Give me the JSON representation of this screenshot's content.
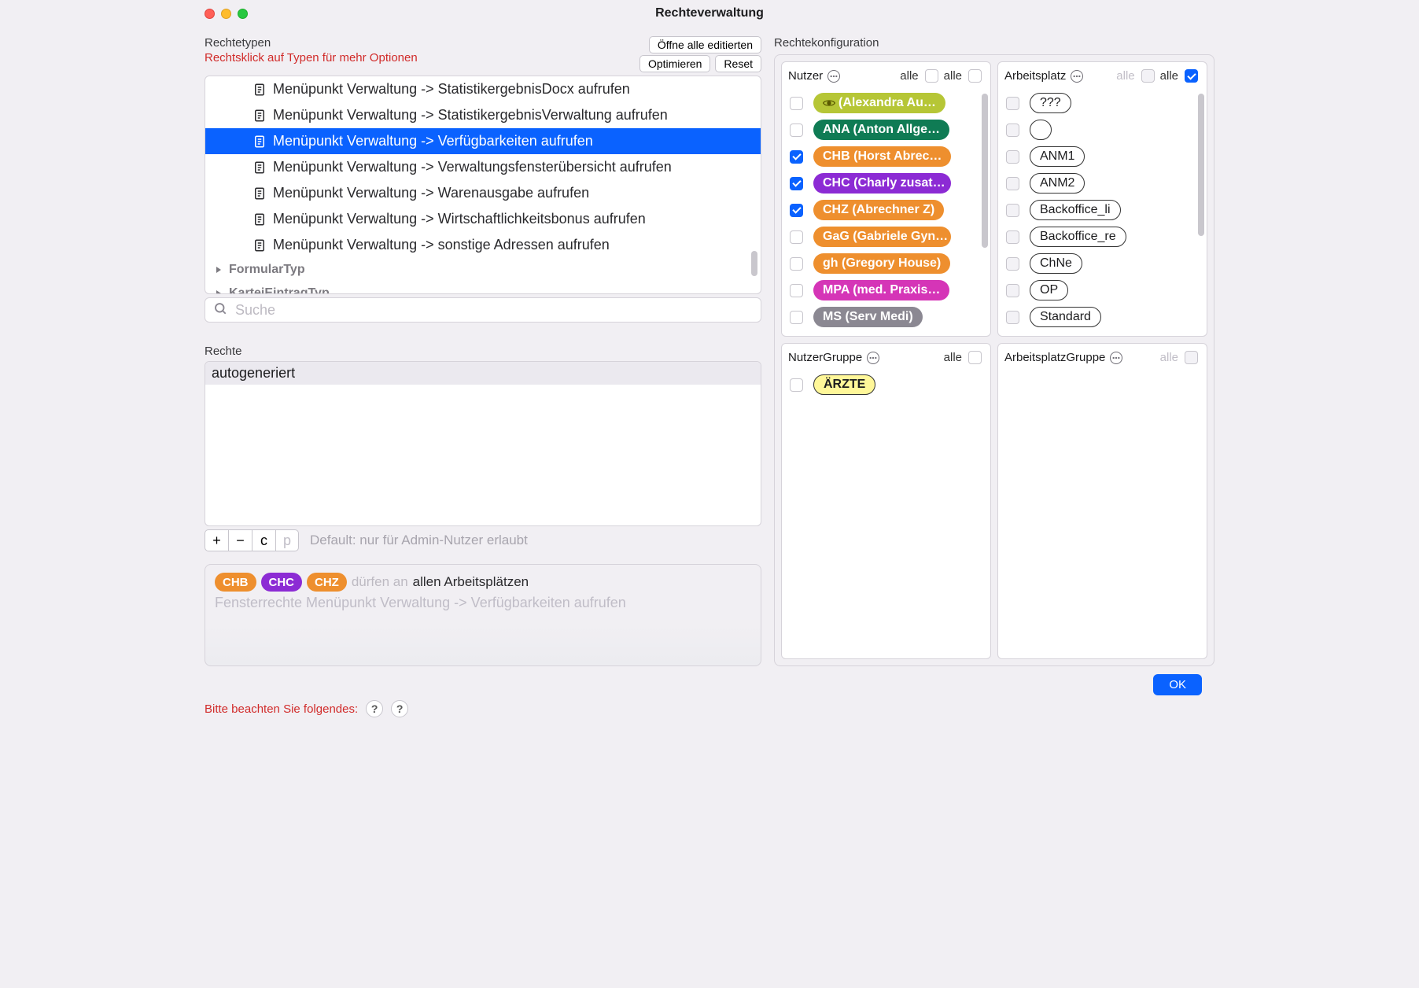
{
  "window": {
    "title": "Rechteverwaltung"
  },
  "left": {
    "header": "Rechtetypen",
    "sub": "Rechtsklick auf Typen für mehr Optionen",
    "buttons": {
      "open_all": "Öffne alle editierten",
      "optimize": "Optimieren",
      "reset": "Reset"
    },
    "tree": {
      "items": [
        "Menüpunkt Verwaltung -> StatistikergebnisDocx aufrufen",
        "Menüpunkt Verwaltung -> StatistikergebnisVerwaltung aufrufen",
        "Menüpunkt Verwaltung -> Verfügbarkeiten aufrufen",
        "Menüpunkt Verwaltung -> Verwaltungsfensterübersicht aufrufen",
        "Menüpunkt Verwaltung -> Warenausgabe aufrufen",
        "Menüpunkt Verwaltung -> Wirtschaftlichkeitsbonus aufrufen",
        "Menüpunkt Verwaltung -> sonstige Adressen aufrufen"
      ],
      "selected_index": 2,
      "groups": [
        "FormularTyp",
        "KarteiEintragTyp"
      ]
    },
    "search_placeholder": "Suche",
    "rights_header": "Rechte",
    "rights_list": [
      "autogeneriert"
    ],
    "toolbar": {
      "add": "+",
      "remove": "−",
      "copy": "c",
      "paste": "p"
    },
    "default_text": "Default: nur für Admin-Nutzer erlaubt",
    "desc": {
      "tags": [
        {
          "label": "CHB",
          "color": "#ee8f2e"
        },
        {
          "label": "CHC",
          "color": "#8c2bd4"
        },
        {
          "label": "CHZ",
          "color": "#ee8f2e"
        }
      ],
      "allow_text": "dürfen an",
      "scope": "allen Arbeitsplätzen",
      "line2": "Fensterrechte Menüpunkt Verwaltung -> Verfügbarkeiten aufrufen"
    }
  },
  "right": {
    "header": "Rechtekonfiguration",
    "boxes": {
      "nutzer": {
        "title": "Nutzer",
        "all1": "alle",
        "all2": "alle",
        "items": [
          {
            "label": " (Alexandra Au…",
            "color": "#b6c636",
            "checked": false,
            "eye": true
          },
          {
            "label": "ANA (Anton Allge…",
            "color": "#0f7b54",
            "checked": false
          },
          {
            "label": "CHB (Horst Abrec…",
            "color": "#ee8f2e",
            "checked": true
          },
          {
            "label": "CHC (Charly zusat…",
            "color": "#8c2bd4",
            "checked": true
          },
          {
            "label": "CHZ (Abrechner Z)",
            "color": "#ee8f2e",
            "checked": true
          },
          {
            "label": "GaG (Gabriele Gyn…",
            "color": "#ee8f2e",
            "checked": false
          },
          {
            "label": "gh (Gregory House)",
            "color": "#ee8f2e",
            "checked": false
          },
          {
            "label": "MPA (med. Praxis…",
            "color": "#d535b7",
            "checked": false
          },
          {
            "label": "MS (Serv Medi)",
            "color": "#8b8892",
            "checked": false
          }
        ]
      },
      "arbeitsplatz": {
        "title": "Arbeitsplatz",
        "all1": "alle",
        "all2": "alle",
        "all2_checked": true,
        "items": [
          "???",
          "",
          "ANM1",
          "ANM2",
          "Backoffice_li",
          "Backoffice_re",
          "ChNe",
          "OP",
          "Standard"
        ]
      },
      "nutzergruppe": {
        "title": "NutzerGruppe",
        "all": "alle",
        "items": [
          "ÄRZTE"
        ]
      },
      "arbeitsplatzgruppe": {
        "title": "ArbeitsplatzGruppe",
        "all": "alle"
      }
    }
  },
  "footer": {
    "notice": "Bitte beachten Sie folgendes:",
    "ok": "OK"
  }
}
